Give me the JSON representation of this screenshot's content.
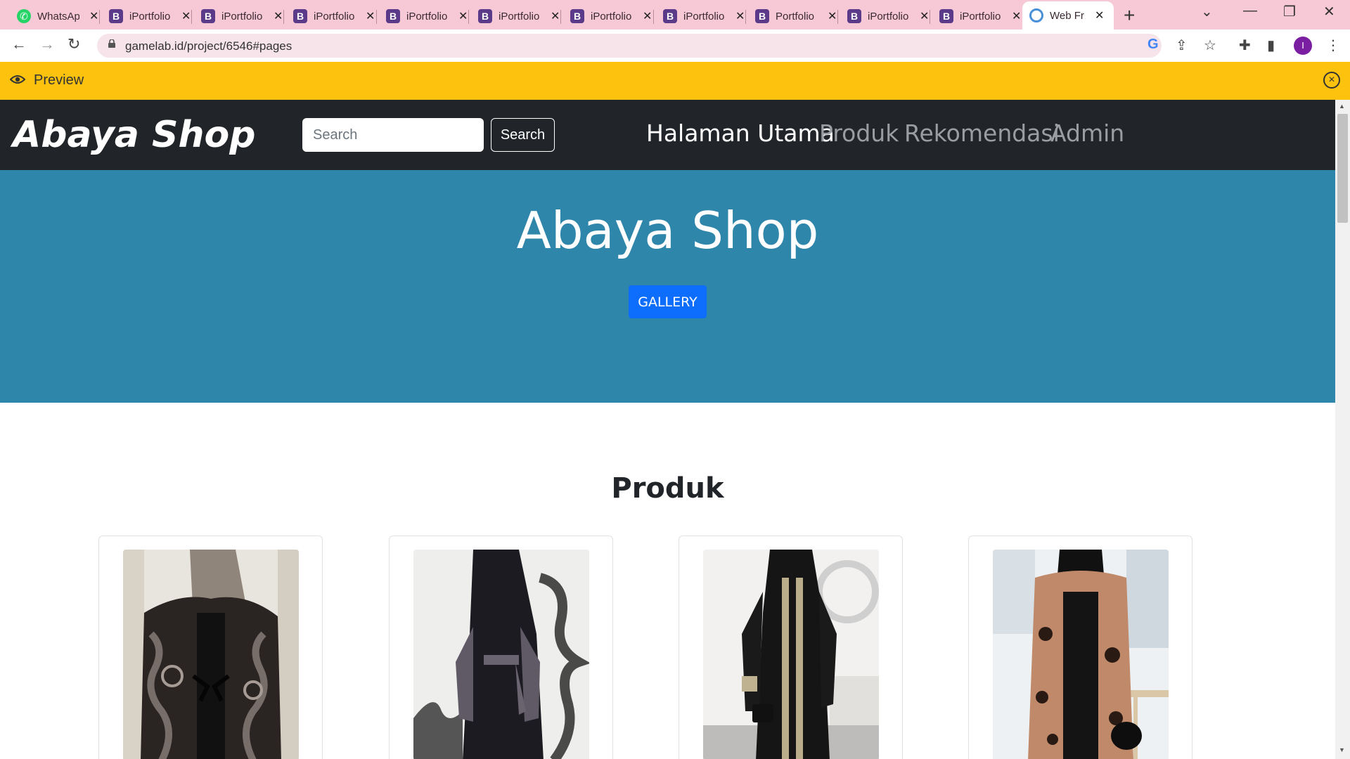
{
  "browser": {
    "tabs": [
      {
        "title": "WhatsApp",
        "favicon": "whatsapp-icon"
      },
      {
        "title": "iPortfolio",
        "favicon": "bootstrap-icon"
      },
      {
        "title": "iPortfolio",
        "favicon": "bootstrap-icon"
      },
      {
        "title": "iPortfolio",
        "favicon": "bootstrap-icon"
      },
      {
        "title": "iPortfolio",
        "favicon": "bootstrap-icon"
      },
      {
        "title": "iPortfolio",
        "favicon": "bootstrap-icon"
      },
      {
        "title": "iPortfolio",
        "favicon": "bootstrap-icon"
      },
      {
        "title": "iPortfolio",
        "favicon": "bootstrap-icon"
      },
      {
        "title": "Portfolio",
        "favicon": "bootstrap-icon"
      },
      {
        "title": "iPortfolio",
        "favicon": "bootstrap-icon"
      },
      {
        "title": "iPortfolio",
        "favicon": "bootstrap-icon"
      },
      {
        "title": "Web Fr",
        "favicon": "web-icon"
      }
    ],
    "url": "gamelab.id/project/6546#pages",
    "profile_initial": "I"
  },
  "preview_bar": {
    "label": "Preview",
    "color": "#fcc20e"
  },
  "site": {
    "brand": "Abaya Shop",
    "search": {
      "placeholder": "Search",
      "button_label": "Search"
    },
    "nav": [
      {
        "label": "Halaman Utama",
        "active": true
      },
      {
        "label": "Produk",
        "active": false
      },
      {
        "label": "Rekomendasi",
        "active": false
      },
      {
        "label": "Admin",
        "active": false
      }
    ],
    "hero": {
      "title": "Abaya Shop",
      "button_label": "GALLERY",
      "background": "#2f86ab",
      "button_color": "#0d6efd"
    },
    "produk": {
      "title": "Produk"
    }
  }
}
